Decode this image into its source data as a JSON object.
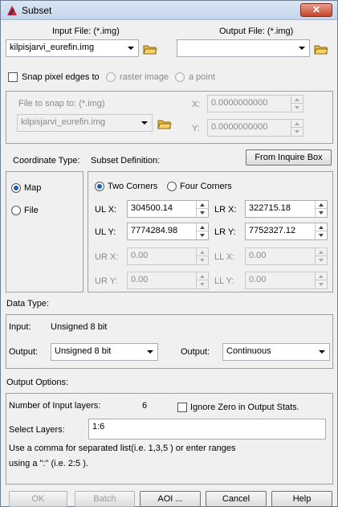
{
  "window": {
    "title": "Subset",
    "close": "✕"
  },
  "input_file": {
    "label": "Input File: (*.img)",
    "value": "kilpisjarvi_eurefin.img"
  },
  "output_file": {
    "label": "Output File: (*.img)",
    "value": ""
  },
  "snap": {
    "label": "Snap pixel edges to",
    "raster_label": "raster image",
    "point_label": "a point",
    "file_label": "File to snap to: (*.img)",
    "file_value": "kilpisjarvi_eurefin.img",
    "x_label": "X:",
    "x_value": "0.0000000000",
    "y_label": "Y:",
    "y_value": "0.0000000000"
  },
  "coord": {
    "label": "Coordinate Type:",
    "map": "Map",
    "file": "File"
  },
  "subset": {
    "label": "Subset Definition:",
    "inquire_button": "From Inquire Box",
    "two_corners": "Two Corners",
    "four_corners": "Four Corners",
    "ulx_label": "UL X:",
    "ulx": "304500.14",
    "lrx_label": "LR X:",
    "lrx": "322715.18",
    "uly_label": "UL Y:",
    "uly": "7774284.98",
    "lry_label": "LR Y:",
    "lry": "7752327.12",
    "urx_label": "UR X:",
    "urx": "0.00",
    "llx_label": "LL X:",
    "llx": "0.00",
    "ury_label": "UR Y:",
    "ury": "0.00",
    "lly_label": "LL Y:",
    "lly": "0.00"
  },
  "data_type": {
    "label": "Data Type:",
    "input_label": "Input:",
    "input_value": "Unsigned 8 bit",
    "output_label": "Output:",
    "output_value": "Unsigned 8 bit",
    "output2_label": "Output:",
    "output2_value": "Continuous"
  },
  "output_options": {
    "label": "Output Options:",
    "layers_label": "Number of Input layers:",
    "layers_value": "6",
    "ignore_zero": "Ignore Zero in Output Stats.",
    "select_label": "Select Layers:",
    "select_value": "1:6",
    "hint1": "Use a comma for separated list(i.e. 1,3,5 ) or enter ranges",
    "hint2": "using a \":\" (i.e. 2:5 )."
  },
  "buttons": {
    "ok": "OK",
    "batch": "Batch",
    "aoi": "AOI ...",
    "cancel": "Cancel",
    "help": "Help"
  }
}
